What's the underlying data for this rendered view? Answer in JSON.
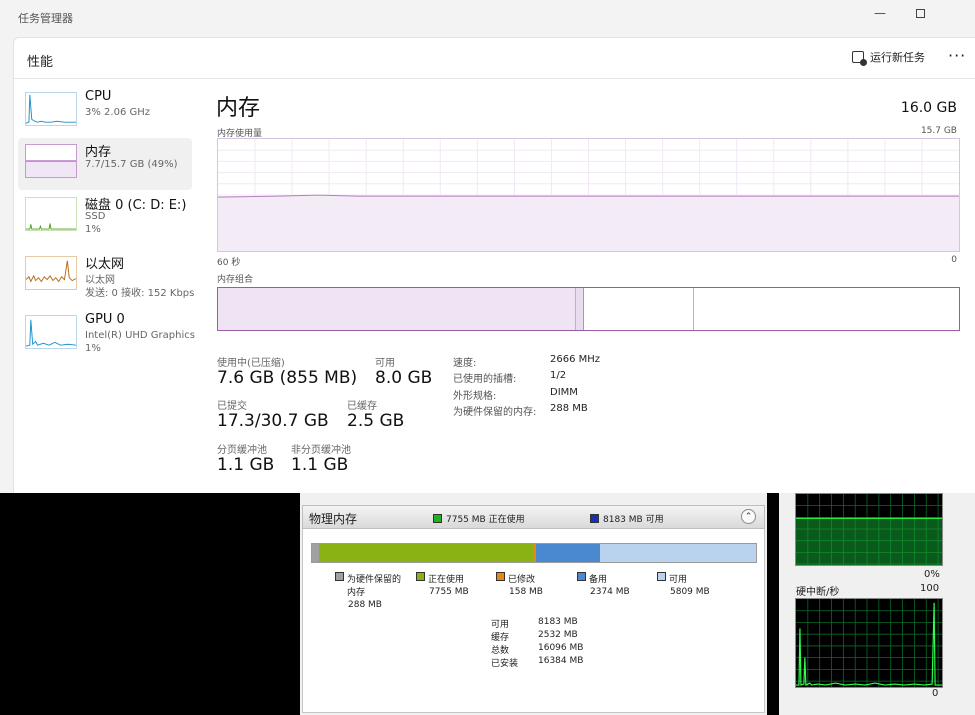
{
  "window": {
    "title": "任务管理器",
    "minimize_icon": "minimize-icon",
    "maximize_icon": "maximize-icon"
  },
  "header": {
    "title": "性能",
    "run_task_label": "运行新任务",
    "more_label": "···"
  },
  "sidebar": {
    "items": [
      {
        "name": "CPU",
        "sub1": "3% 2.06 GHz",
        "sub2": "",
        "sub3": ""
      },
      {
        "name": "内存",
        "sub1": "7.7/15.7 GB (49%)",
        "sub2": "",
        "sub3": ""
      },
      {
        "name": "磁盘 0 (C: D: E:)",
        "sub1": "SSD",
        "sub2": "1%",
        "sub3": ""
      },
      {
        "name": "以太网",
        "sub1": "以太网",
        "sub2": "发送: 0 接收: 152 Kbps",
        "sub3": ""
      },
      {
        "name": "GPU 0",
        "sub1": "Intel(R) UHD Graphics",
        "sub2": "1%",
        "sub3": ""
      }
    ]
  },
  "memory": {
    "title": "内存",
    "total": "16.0 GB",
    "usage_label": "内存使用量",
    "usage_max": "15.7 GB",
    "axis_left": "60 秒",
    "axis_right": "0",
    "composition_label": "内存组合",
    "usage_fraction": 0.49,
    "stats": {
      "in_use_label": "使用中(已压缩)",
      "in_use_value": "7.6 GB (855 MB)",
      "available_label": "可用",
      "available_value": "8.0 GB",
      "committed_label": "已提交",
      "committed_value": "17.3/30.7 GB",
      "cached_label": "已缓存",
      "cached_value": "2.5 GB",
      "paged_label": "分页缓冲池",
      "paged_value": "1.1 GB",
      "nonpaged_label": "非分页缓冲池",
      "nonpaged_value": "1.1 GB"
    },
    "details": [
      {
        "label": "速度:",
        "value": "2666 MHz"
      },
      {
        "label": "已使用的插槽:",
        "value": "1/2"
      },
      {
        "label": "外形规格:",
        "value": "DIMM"
      },
      {
        "label": "为硬件保留的内存:",
        "value": "288 MB"
      }
    ]
  },
  "resource_monitor": {
    "title": "物理内存",
    "legend_in_use": "7755 MB 正在使用",
    "legend_available": "8183 MB 可用",
    "colors": {
      "reserved": "#a0a0a0",
      "in_use": "#8bb214",
      "modified": "#e58a0f",
      "standby": "#4a88cf",
      "free": "#b9d3ef"
    },
    "segments": [
      {
        "key": "reserved",
        "label1": "为硬件保留的",
        "label2": "内存",
        "value": "288 MB"
      },
      {
        "key": "in_use",
        "label1": "正在使用",
        "label2": "",
        "value": "7755 MB"
      },
      {
        "key": "modified",
        "label1": "已修改",
        "label2": "",
        "value": "158 MB"
      },
      {
        "key": "standby",
        "label1": "备用",
        "label2": "",
        "value": "2374 MB"
      },
      {
        "key": "free",
        "label1": "可用",
        "label2": "",
        "value": "5809 MB"
      }
    ],
    "summary": [
      {
        "label": "可用",
        "value": "8183 MB"
      },
      {
        "label": "缓存",
        "value": "2532 MB"
      },
      {
        "label": "总数",
        "value": "16096 MB"
      },
      {
        "label": "已安装",
        "value": "16384 MB"
      }
    ],
    "right_graph1_bottom": "0%",
    "right_graph2_title": "硬中断/秒",
    "right_graph2_top": "100",
    "right_graph2_bottom": "0"
  }
}
